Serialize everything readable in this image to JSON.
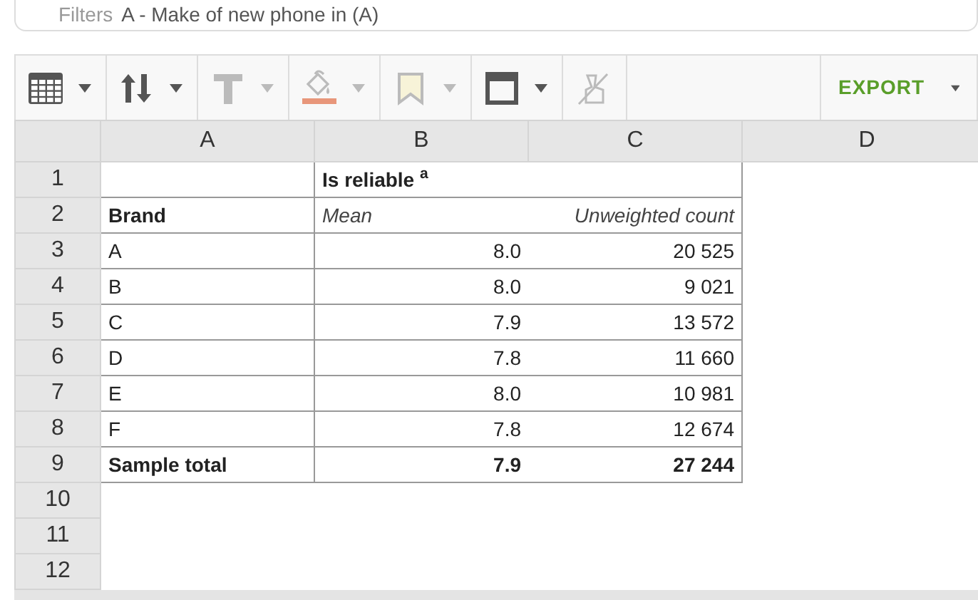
{
  "filters": {
    "label": "Filters",
    "value": "A - Make of new phone in (A)"
  },
  "toolbar": {
    "tools": [
      {
        "kind": "table",
        "disabled": false,
        "dropdown": true
      },
      {
        "kind": "sort",
        "disabled": false,
        "dropdown": true
      },
      {
        "kind": "text",
        "disabled": true,
        "dropdown": true
      },
      {
        "kind": "fill",
        "disabled": true,
        "dropdown": true
      },
      {
        "kind": "bookmark",
        "disabled": true,
        "dropdown": true
      },
      {
        "kind": "border",
        "disabled": false,
        "dropdown": true
      },
      {
        "kind": "clear",
        "disabled": true,
        "dropdown": false
      }
    ],
    "export": "EXPORT"
  },
  "sheet": {
    "columns": [
      "A",
      "B",
      "C",
      "D"
    ],
    "row_numbers": [
      "1",
      "2",
      "3",
      "4",
      "5",
      "6",
      "7",
      "8",
      "9",
      "10",
      "11",
      "12"
    ],
    "title": "Is reliable $^{a}$",
    "header": {
      "label": "Brand",
      "mean": "Mean",
      "count": "Unweighted count"
    },
    "rows": [
      {
        "kind": "data",
        "label": "A",
        "mean": "8.0",
        "count": "20 525"
      },
      {
        "kind": "data",
        "label": "B",
        "mean": "8.0",
        "count": "9 021"
      },
      {
        "kind": "data",
        "label": "C",
        "mean": "7.9",
        "count": "13 572"
      },
      {
        "kind": "data",
        "label": "D",
        "mean": "7.8",
        "count": "11 660"
      },
      {
        "kind": "data",
        "label": "E",
        "mean": "8.0",
        "count": "10 981"
      },
      {
        "kind": "data",
        "label": "F",
        "mean": "7.8",
        "count": "12 674"
      },
      {
        "kind": "total",
        "label": "Sample total",
        "mean": "7.9",
        "count": "27 244"
      }
    ]
  }
}
